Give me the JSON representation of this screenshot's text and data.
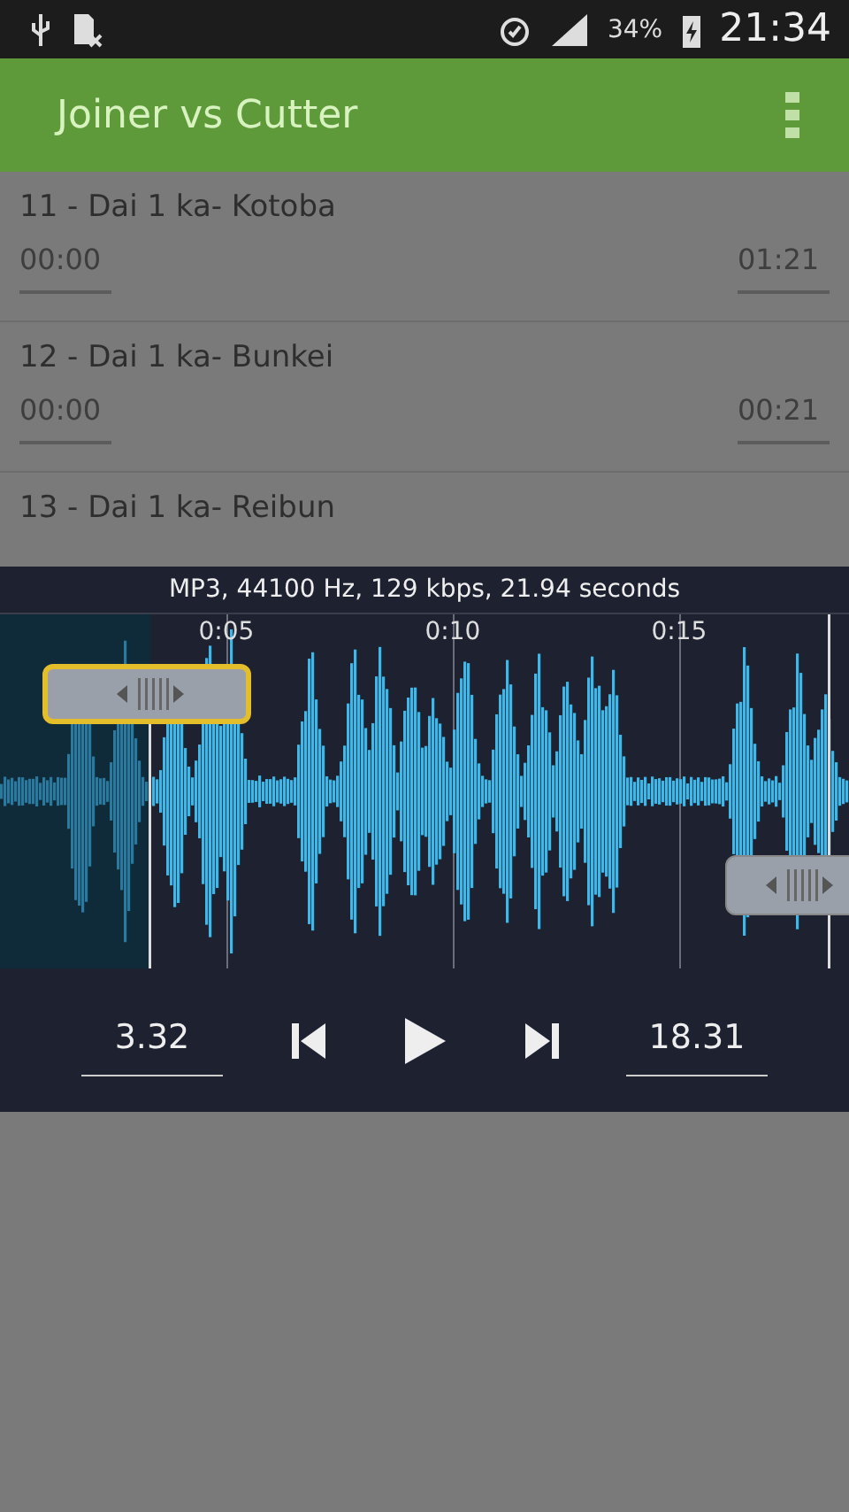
{
  "status_bar": {
    "battery": "34%",
    "time": "21:34"
  },
  "app_bar": {
    "title": "Joiner vs Cutter"
  },
  "tracks": [
    {
      "title": "11 - Dai 1 ka- Kotoba",
      "start": "00:00",
      "end": "01:21"
    },
    {
      "title": "12 - Dai 1 ka- Bunkei",
      "start": "00:00",
      "end": "00:21"
    },
    {
      "title": "13 - Dai 1 ka- Reibun"
    }
  ],
  "editor": {
    "info": "MP3, 44100 Hz, 129 kbps, 21.94 seconds",
    "ticks": [
      "0:05",
      "0:10",
      "0:15"
    ],
    "start_handle": {
      "selected": true
    },
    "end_handle": {
      "selected": false
    },
    "start_value": "3.32",
    "end_value": "18.31"
  }
}
